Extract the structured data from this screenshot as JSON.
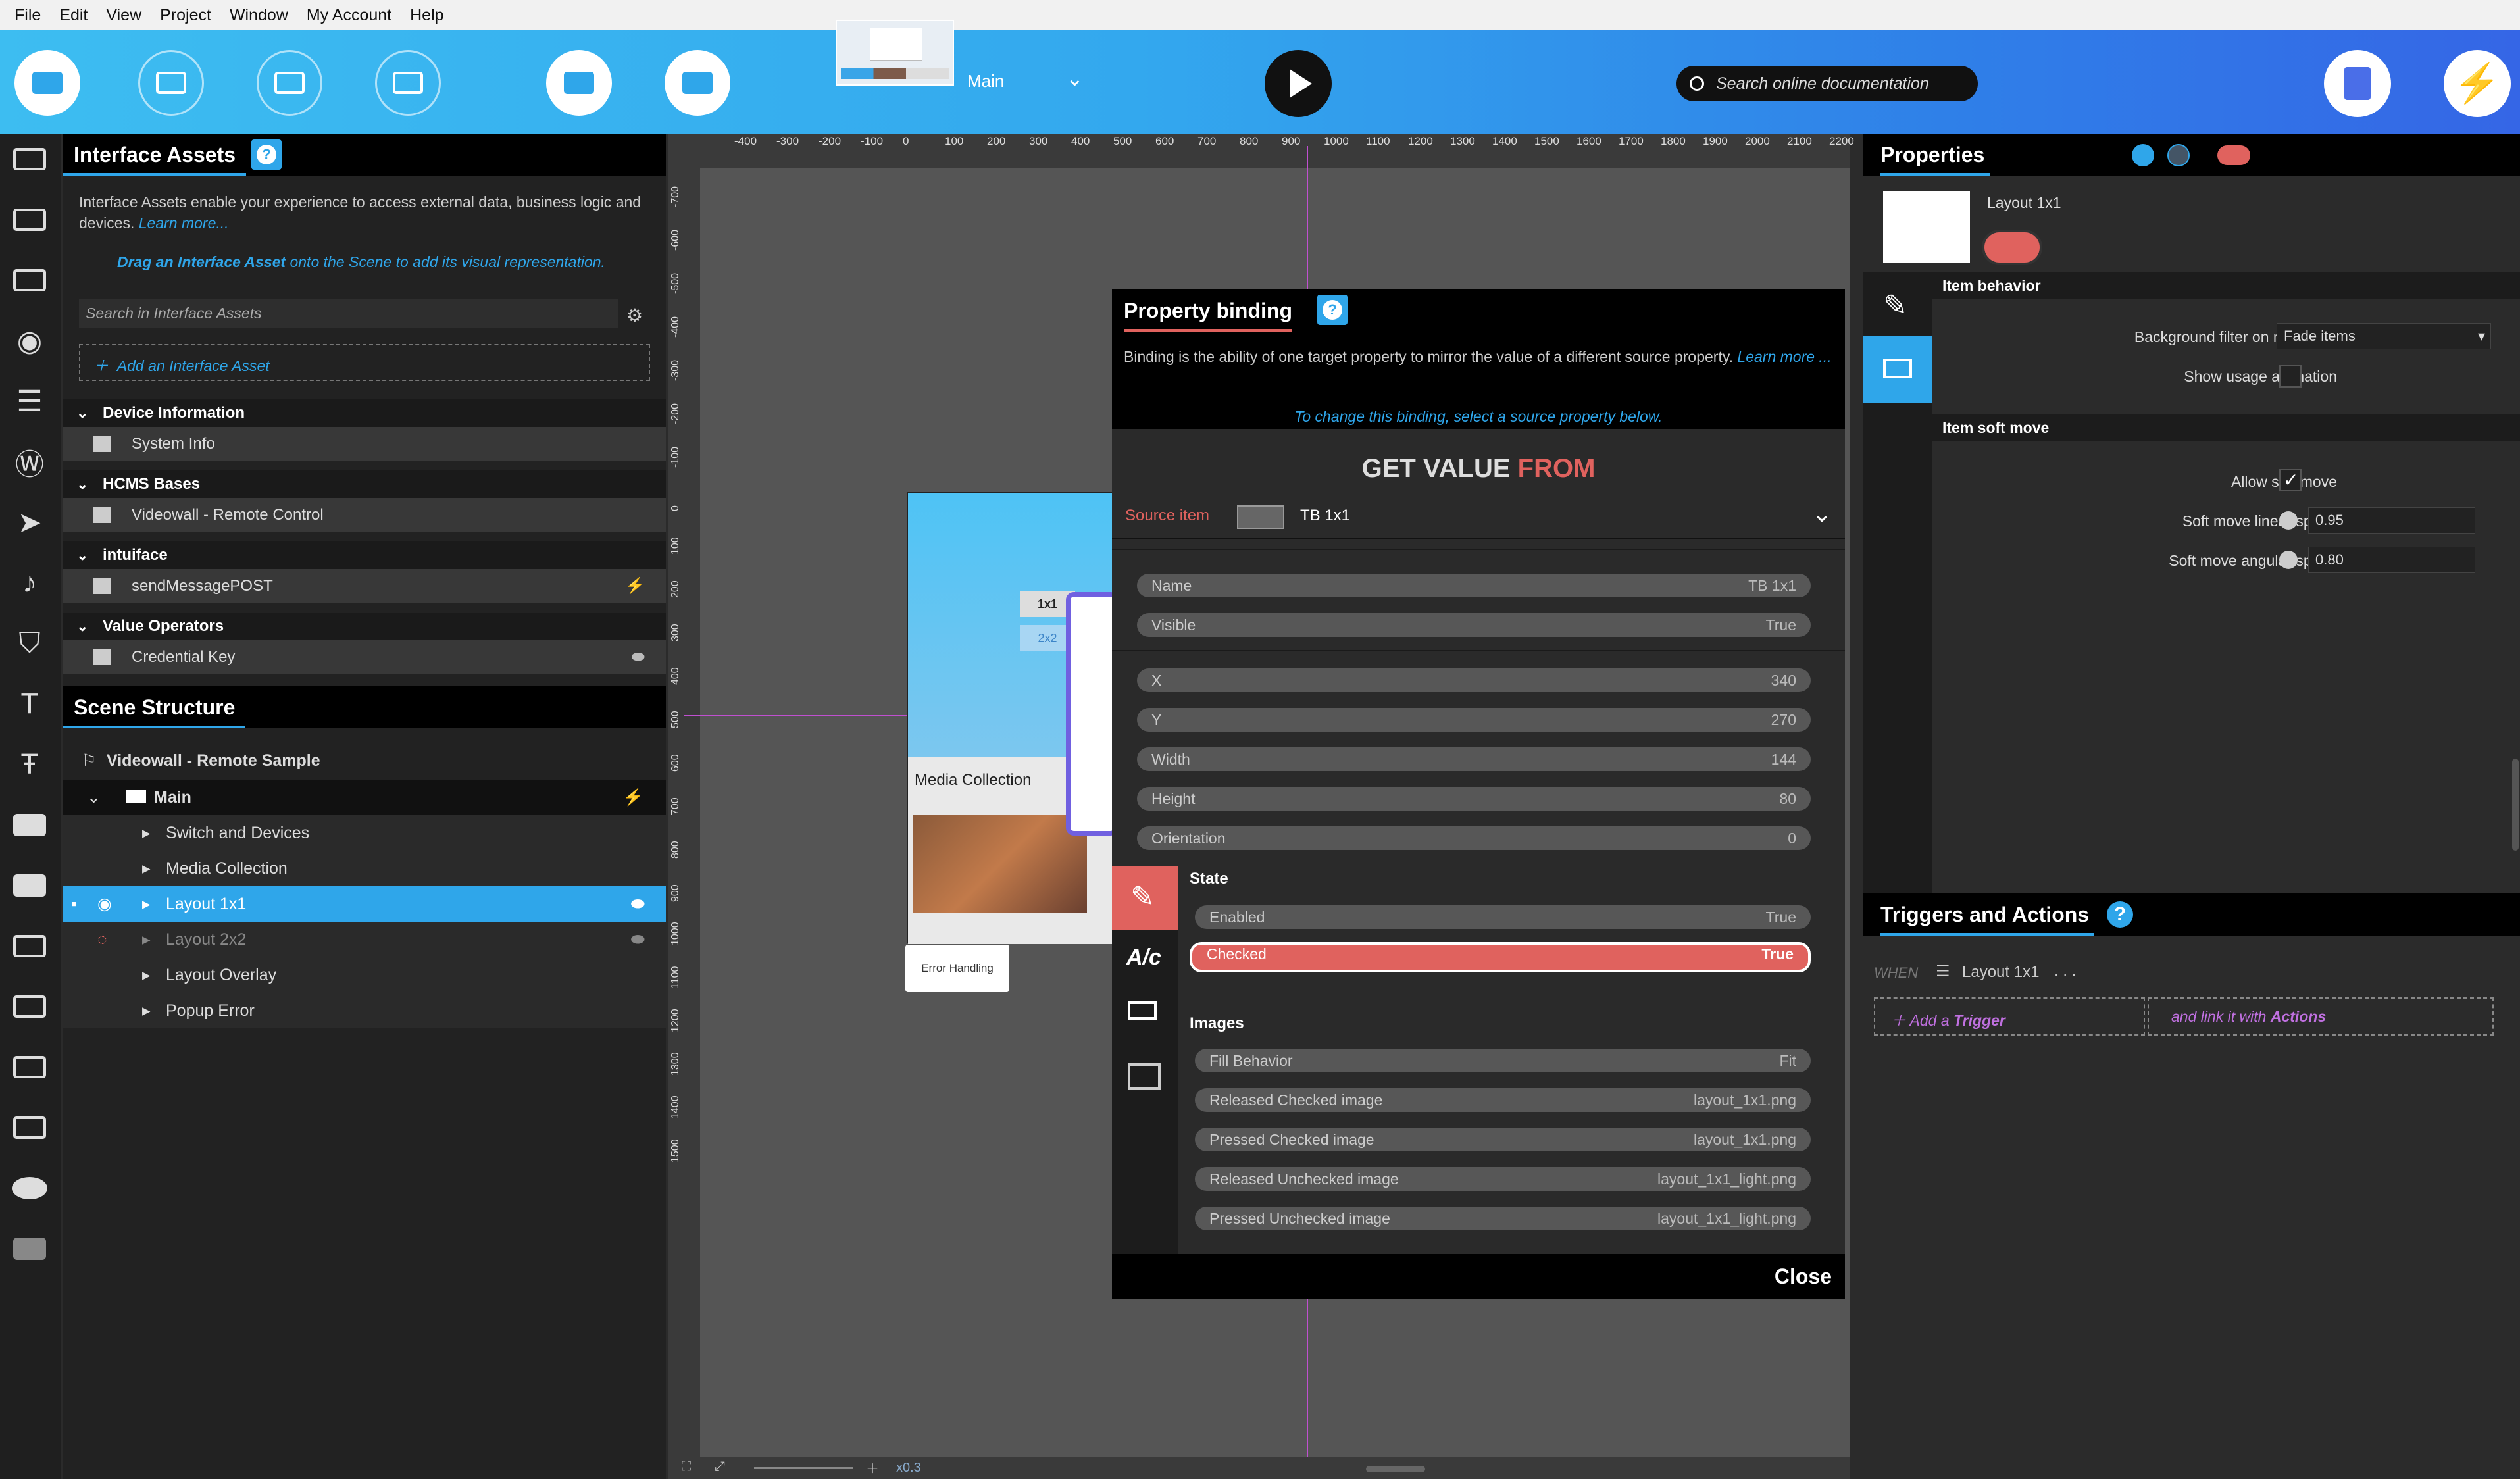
{
  "menubar": [
    "File",
    "Edit",
    "View",
    "Project",
    "Window",
    "My Account",
    "Help"
  ],
  "toolbar": {
    "scene_name": "Main",
    "search_placeholder": "Search online documentation",
    "icons": [
      "interface-icon",
      "devices-icon",
      "hierarchy-icon",
      "folder-icon",
      "assets-icon",
      "layers-icon"
    ]
  },
  "interface_assets": {
    "title": "Interface Assets",
    "help": "?",
    "description": "Interface Assets enable your experience to access external data, business logic and devices.",
    "learn_more": "Learn more...",
    "drag_hint_bold": "Drag an Interface Asset",
    "drag_hint_rest": " onto the Scene to add its visual representation.",
    "search_placeholder": "Search in Interface Assets",
    "add_label": "Add an Interface Asset",
    "sections": [
      {
        "name": "Device Information",
        "items": [
          {
            "label": "System Info"
          }
        ]
      },
      {
        "name": "HCMS Bases",
        "items": [
          {
            "label": "Videowall - Remote Control"
          }
        ]
      },
      {
        "name": "intuiface",
        "items": [
          {
            "label": "sendMessagePOST"
          }
        ]
      },
      {
        "name": "Value Operators",
        "items": [
          {
            "label": "Credential Key"
          }
        ]
      }
    ]
  },
  "scene_structure": {
    "title": "Scene Structure",
    "root": "Videowall - Remote Sample",
    "scene": "Main",
    "items": [
      "Switch and Devices",
      "Media Collection",
      "Layout 1x1",
      "Layout 2x2",
      "Layout Overlay",
      "Popup Error"
    ],
    "selected": "Layout 1x1"
  },
  "canvas": {
    "top_ruler": [
      "-400",
      "-300",
      "-200",
      "-100",
      "0",
      "100",
      "200",
      "300",
      "400",
      "500",
      "600",
      "700",
      "800",
      "900",
      "1000",
      "1100",
      "1200",
      "1300",
      "1400",
      "1500",
      "1600",
      "1700",
      "1800",
      "1900",
      "2000",
      "2100",
      "2200"
    ],
    "left_ruler": [
      "-700",
      "-600",
      "-500",
      "-400",
      "-300",
      "-200",
      "-100",
      "0",
      "100",
      "200",
      "300",
      "400",
      "500",
      "600",
      "700",
      "800",
      "900",
      "1000",
      "1100",
      "1200",
      "1300",
      "1400",
      "1500"
    ],
    "stage_1x1": "1x1",
    "stage_2x2": "2x2",
    "media_collection": "Media Collection",
    "error_button": "Error Handling",
    "zoom": "x0.3"
  },
  "property_binding": {
    "title": "Property binding",
    "help": "?",
    "intro": "Binding is the ability of one target property to mirror the value of a different source property.",
    "learn": "Learn more ...",
    "hint": "To change this binding, select a source property below.",
    "get_value": "GET VALUE",
    "from": "FROM",
    "source_label": "Source item",
    "source_value": "TB 1x1",
    "group1": [
      {
        "name": "Name",
        "value": "TB 1x1"
      },
      {
        "name": "Visible",
        "value": "True"
      }
    ],
    "group2": [
      {
        "name": "X",
        "value": "340"
      },
      {
        "name": "Y",
        "value": "270"
      },
      {
        "name": "Width",
        "value": "144"
      },
      {
        "name": "Height",
        "value": "80"
      },
      {
        "name": "Orientation",
        "value": "0"
      }
    ],
    "state_title": "State",
    "state": [
      {
        "name": "Enabled",
        "value": "True"
      },
      {
        "name": "Checked",
        "value": "True"
      }
    ],
    "images_title": "Images",
    "images": [
      {
        "name": "Fill Behavior",
        "value": "Fit"
      },
      {
        "name": "Released Checked image",
        "value": "layout_1x1.png"
      },
      {
        "name": "Pressed Checked image",
        "value": "layout_1x1.png"
      },
      {
        "name": "Released Unchecked image",
        "value": "layout_1x1_light.png"
      },
      {
        "name": "Pressed Unchecked image",
        "value": "layout_1x1_light.png"
      }
    ],
    "close": "Close"
  },
  "properties": {
    "title": "Properties",
    "item_name": "Layout 1x1",
    "item_behavior": "Item behavior",
    "bg_filter_label": "Background filter on maximize",
    "bg_filter_value": "Fade items",
    "show_usage_label": "Show usage animation",
    "soft_move": "Item soft move",
    "allow_soft_label": "Allow soft move",
    "linear_label": "Soft move linear speed",
    "linear_value": "0.95",
    "angular_label": "Soft move angular speed",
    "angular_value": "0.80"
  },
  "triggers": {
    "title": "Triggers and Actions",
    "help": "?",
    "when": "WHEN",
    "item": "Layout 1x1",
    "dots": ". . .",
    "add_prefix": "Add a ",
    "add_trigger": "Trigger",
    "link_prefix": "and link it with ",
    "link_actions": "Actions"
  },
  "colors": {
    "accent": "#2fa6ea",
    "binding": "#e0625e",
    "guide": "#c050d0"
  }
}
